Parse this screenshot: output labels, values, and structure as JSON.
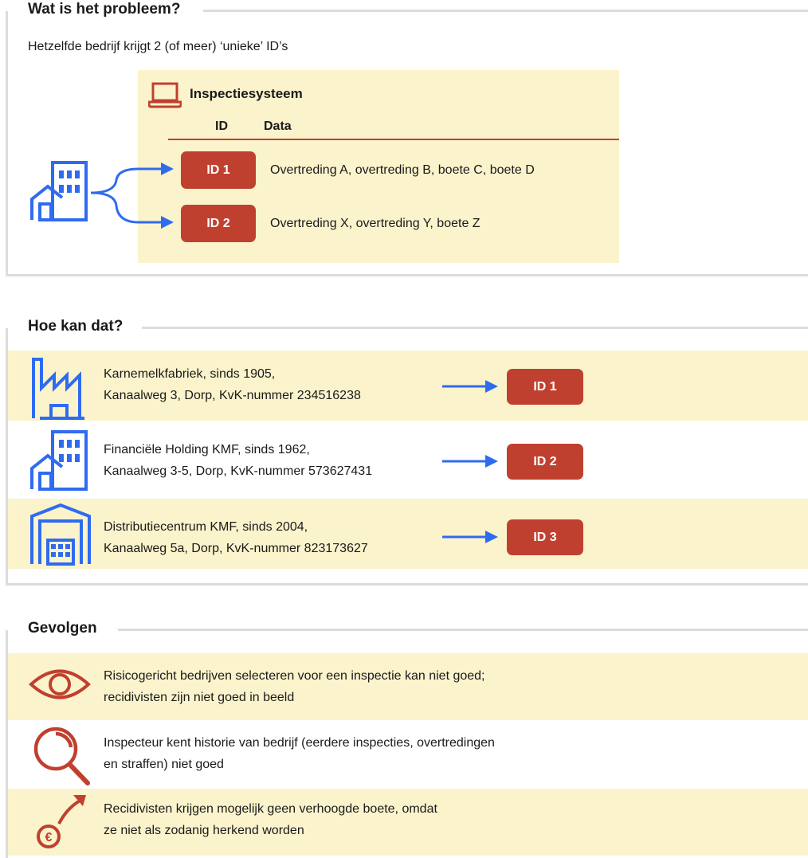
{
  "colors": {
    "accent_red": "#c0402f",
    "icon_blue": "#2f6bf0",
    "band_yellow": "#fbf3cc",
    "divider_grey": "#dcdcdc"
  },
  "section1": {
    "heading": "Wat is het probleem?",
    "subtitle": "Hetzelfde bedrijf krijgt 2 (of meer) ‘unieke’ ID’s",
    "system": {
      "icon": "laptop-icon",
      "title": "Inspectiesysteem",
      "col_id": "ID",
      "col_data": "Data",
      "rows": [
        {
          "id": "ID 1",
          "data": "Overtreding A, overtreding B, boete C, boete D"
        },
        {
          "id": "ID 2",
          "data": "Overtreding X, overtreding Y, boete Z"
        }
      ]
    },
    "company_icon": "office-building-icon"
  },
  "section2": {
    "heading": "Hoe kan dat?",
    "rows": [
      {
        "icon": "factory-icon",
        "line1": "Karnemelkfabriek, sinds 1905,",
        "line2": "Kanaalweg 3, Dorp, KvK-nummer 234516238",
        "id": "ID 1"
      },
      {
        "icon": "office-building-icon",
        "line1": "Financiële Holding KMF, sinds 1962,",
        "line2": "Kanaalweg 3-5, Dorp, KvK-nummer 573627431",
        "id": "ID 2"
      },
      {
        "icon": "warehouse-icon",
        "line1": "Distributiecentrum KMF, sinds 2004,",
        "line2": "Kanaalweg 5a, Dorp, KvK-nummer 823173627",
        "id": "ID 3"
      }
    ]
  },
  "section3": {
    "heading": "Gevolgen",
    "rows": [
      {
        "icon": "eye-icon",
        "line1": "Risicogericht bedrijven selecteren voor een inspectie kan niet goed;",
        "line2": "recidivisten zijn niet goed in beeld"
      },
      {
        "icon": "magnifier-icon",
        "line1": "Inspecteur kent historie van bedrijf (eerdere inspecties, overtredingen",
        "line2": "en straffen) niet goed"
      },
      {
        "icon": "euro-increase-icon",
        "line1": "Recidivisten krijgen mogelijk geen verhoogde boete, omdat",
        "line2": "ze niet als zodanig herkend worden",
        "icon_text": "€"
      }
    ]
  }
}
